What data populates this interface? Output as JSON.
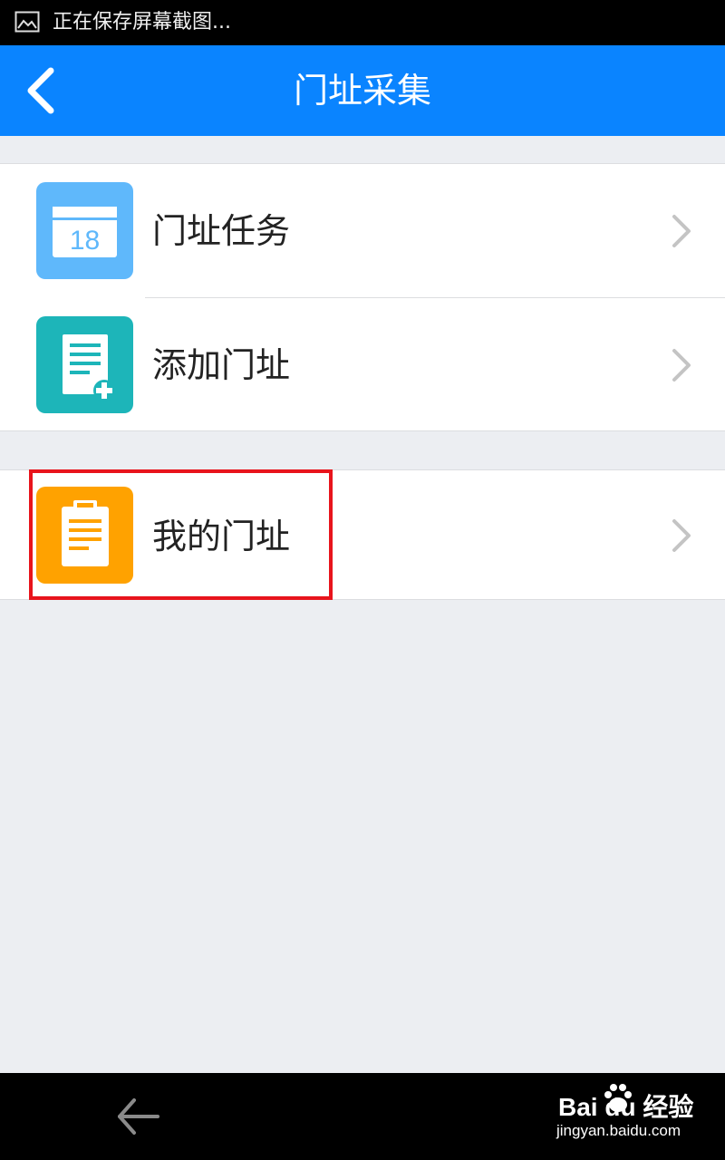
{
  "status_bar": {
    "text": "正在保存屏幕截图..."
  },
  "header": {
    "title": "门址采集"
  },
  "menu": {
    "items": [
      {
        "label": "门址任务",
        "icon": "calendar-icon",
        "icon_text": "18",
        "color": "#5FB8FB"
      },
      {
        "label": "添加门址",
        "icon": "add-document-icon",
        "color": "#1DB5B9"
      },
      {
        "label": "我的门址",
        "icon": "clipboard-icon",
        "color": "#FFA200"
      }
    ]
  },
  "highlight": {
    "color": "#E8141C"
  },
  "watermark": {
    "brand": "Bai du 经验",
    "url": "jingyan.baidu.com"
  },
  "colors": {
    "primary": "#0A84FF",
    "background": "#ECEEF2"
  }
}
